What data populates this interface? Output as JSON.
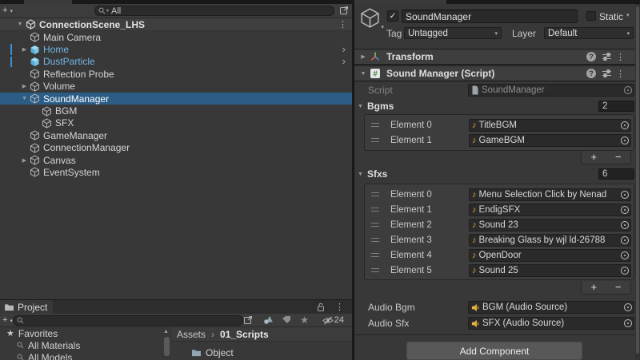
{
  "colors": {
    "sel": "#2C5D87",
    "prefab-text": "#72B5E3",
    "prefab-bar": "#3E8FD8",
    "note": "#E8A33D",
    "audio": "#E8B33D"
  },
  "hierarchy": {
    "create_button": "+",
    "search_text": "All",
    "scene": {
      "label": "ConnectionScene_LHS"
    },
    "rows": [
      {
        "label": "Main Camera",
        "indent": 1,
        "icon": "cube"
      },
      {
        "label": "Home",
        "indent": 1,
        "icon": "prefab",
        "arrow": "right",
        "prefab": true,
        "bar": true,
        "chevron": true
      },
      {
        "label": "DustParticle",
        "indent": 1,
        "icon": "prefab",
        "prefab": true,
        "bar": true,
        "chevron": true
      },
      {
        "label": "Reflection Probe",
        "indent": 1,
        "icon": "cube"
      },
      {
        "label": "Volume",
        "indent": 1,
        "icon": "cube",
        "arrow": "right"
      },
      {
        "label": "SoundManager",
        "indent": 1,
        "icon": "cube",
        "arrow": "down",
        "selected": true
      },
      {
        "label": "BGM",
        "indent": 2,
        "icon": "cube"
      },
      {
        "label": "SFX",
        "indent": 2,
        "icon": "cube"
      },
      {
        "label": "GameManager",
        "indent": 1,
        "icon": "cube"
      },
      {
        "label": "ConnectionManager",
        "indent": 1,
        "icon": "cube"
      },
      {
        "label": "Canvas",
        "indent": 1,
        "icon": "cube",
        "arrow": "right"
      },
      {
        "label": "EventSystem",
        "indent": 1,
        "icon": "cube"
      }
    ]
  },
  "project": {
    "tab_label": "Project",
    "create_button": "+",
    "hidden_count": "24",
    "favorites_label": "Favorites",
    "favorites": [
      {
        "label": "All Materials"
      },
      {
        "label": "All Models"
      }
    ],
    "breadcrumb": {
      "root": "Assets",
      "sep": "›",
      "current": "01_Scripts"
    },
    "folders": [
      {
        "label": "Object"
      }
    ]
  },
  "inspector": {
    "header": {
      "name": "SoundManager",
      "static_label": "Static",
      "check_glyph": "✓",
      "tag_label": "Tag",
      "tag_value": "Untagged",
      "layer_label": "Layer",
      "layer_value": "Default"
    },
    "transform": {
      "title": "Transform",
      "help_glyph": "?"
    },
    "script_component": {
      "title": "Sound Manager (Script)",
      "help_glyph": "?",
      "script_row": {
        "label": "Script",
        "value": "SoundManager"
      },
      "bgms": {
        "label": "Bgms",
        "size": "2",
        "elements": [
          {
            "label": "Element 0",
            "value": "TitleBGM"
          },
          {
            "label": "Element 1",
            "value": "GameBGM"
          }
        ]
      },
      "sfxs": {
        "label": "Sfxs",
        "size": "6",
        "elements": [
          {
            "label": "Element 0",
            "value": "Menu Selection Click by Nenad"
          },
          {
            "label": "Element 1",
            "value": "EndigSFX"
          },
          {
            "label": "Element 2",
            "value": "Sound 23"
          },
          {
            "label": "Element 3",
            "value": "Breaking Glass by wjl ld-26788"
          },
          {
            "label": "Element 4",
            "value": "OpenDoor"
          },
          {
            "label": "Element 5",
            "value": "Sound 25"
          }
        ]
      },
      "audio_bgm": {
        "label": "Audio Bgm",
        "value": "BGM (Audio Source)"
      },
      "audio_sfx": {
        "label": "Audio Sfx",
        "value": "SFX (Audio Source)"
      },
      "plus": "+",
      "minus": "−"
    },
    "add_component_label": "Add Component"
  },
  "glyphs": {
    "fold_open": "▼",
    "fold_closed": "▶",
    "dropdown": "▾",
    "menu": "⋮",
    "chevron": "›",
    "star": "★",
    "note": "♪",
    "scroll_up": "▲"
  }
}
